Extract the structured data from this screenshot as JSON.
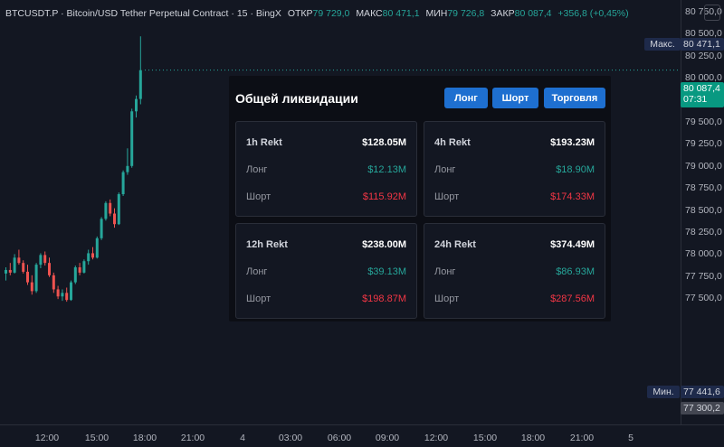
{
  "header": {
    "symbol": "BTCUSDT.P",
    "description": "Bitcoin/USD Tether Perpetual Contract",
    "interval": "15",
    "exchange": "BingX",
    "open_label": "ОТКР",
    "open": "79 729,0",
    "high_label": "МАКС",
    "high": "80 471,1",
    "low_label": "МИН",
    "low": "79 726,8",
    "close_label": "ЗАКР",
    "close": "80 087,4",
    "change": "+356,8 (+0,45%)"
  },
  "price_axis": {
    "ticks": [
      "80 750,0",
      "80 500,0",
      "80 250,0",
      "80 000,0",
      "79 750,0",
      "79 500,0",
      "79 250,0",
      "79 000,0",
      "78 750,0",
      "78 500,0",
      "78 250,0",
      "78 000,0",
      "77 750,0",
      "77 500,0"
    ],
    "max_tag": "Макс.",
    "max_value": "80 471,1",
    "last_price": "80 087,4",
    "countdown": "07:31",
    "min_tag": "Мин.",
    "min_value": "77 441,6",
    "low_value": "77 300,2"
  },
  "time_axis": [
    "12:00",
    "15:00",
    "18:00",
    "21:00",
    "4",
    "03:00",
    "06:00",
    "09:00",
    "12:00",
    "15:00",
    "18:00",
    "21:00",
    "5"
  ],
  "colors": {
    "up": "#26a69a",
    "down": "#ef5350",
    "background": "#131722",
    "button": "#1e6fd0"
  },
  "liquidation": {
    "title": "Общей ликвидации",
    "buttons": {
      "long": "Лонг",
      "short": "Шорт",
      "trade": "Торговля"
    },
    "cards": [
      {
        "period": "1h Rekt",
        "total": "$128.05M",
        "long_label": "Лонг",
        "long": "$12.13M",
        "short_label": "Шорт",
        "short": "$115.92M"
      },
      {
        "period": "4h Rekt",
        "total": "$193.23M",
        "long_label": "Лонг",
        "long": "$18.90M",
        "short_label": "Шорт",
        "short": "$174.33M"
      },
      {
        "period": "12h Rekt",
        "total": "$238.00M",
        "long_label": "Лонг",
        "long": "$39.13M",
        "short_label": "Шорт",
        "short": "$198.87M"
      },
      {
        "period": "24h Rekt",
        "total": "$374.49M",
        "long_label": "Лонг",
        "long": "$86.93M",
        "short_label": "Шорт",
        "short": "$287.56M"
      }
    ]
  },
  "candles": [
    [
      77780,
      77850,
      77700,
      77820
    ],
    [
      77820,
      77900,
      77760,
      77790
    ],
    [
      77790,
      78000,
      77780,
      77960
    ],
    [
      77960,
      78050,
      77880,
      77900
    ],
    [
      77900,
      77930,
      77780,
      77800
    ],
    [
      77800,
      77880,
      77650,
      77680
    ],
    [
      77680,
      77760,
      77540,
      77580
    ],
    [
      77580,
      77900,
      77560,
      77880
    ],
    [
      77880,
      78010,
      77840,
      77990
    ],
    [
      77990,
      78030,
      77870,
      77900
    ],
    [
      77900,
      77960,
      77740,
      77760
    ],
    [
      77760,
      77790,
      77560,
      77600
    ],
    [
      77600,
      77640,
      77490,
      77520
    ],
    [
      77520,
      77600,
      77470,
      77560
    ],
    [
      77560,
      77620,
      77460,
      77480
    ],
    [
      77480,
      77700,
      77470,
      77680
    ],
    [
      77680,
      77870,
      77660,
      77850
    ],
    [
      77850,
      77900,
      77760,
      77790
    ],
    [
      77790,
      77940,
      77780,
      77920
    ],
    [
      77920,
      78050,
      77880,
      78010
    ],
    [
      78010,
      78080,
      77940,
      77960
    ],
    [
      77960,
      78200,
      77950,
      78180
    ],
    [
      78180,
      78420,
      78160,
      78400
    ],
    [
      78400,
      78600,
      78380,
      78580
    ],
    [
      78580,
      78620,
      78430,
      78460
    ],
    [
      78460,
      78520,
      78300,
      78340
    ],
    [
      78340,
      78700,
      78330,
      78680
    ],
    [
      78680,
      78950,
      78660,
      78930
    ],
    [
      78930,
      79200,
      78900,
      79000
    ],
    [
      79000,
      79650,
      78980,
      79620
    ],
    [
      79620,
      79800,
      79550,
      79760
    ],
    [
      79760,
      80471,
      79700,
      80087
    ]
  ]
}
